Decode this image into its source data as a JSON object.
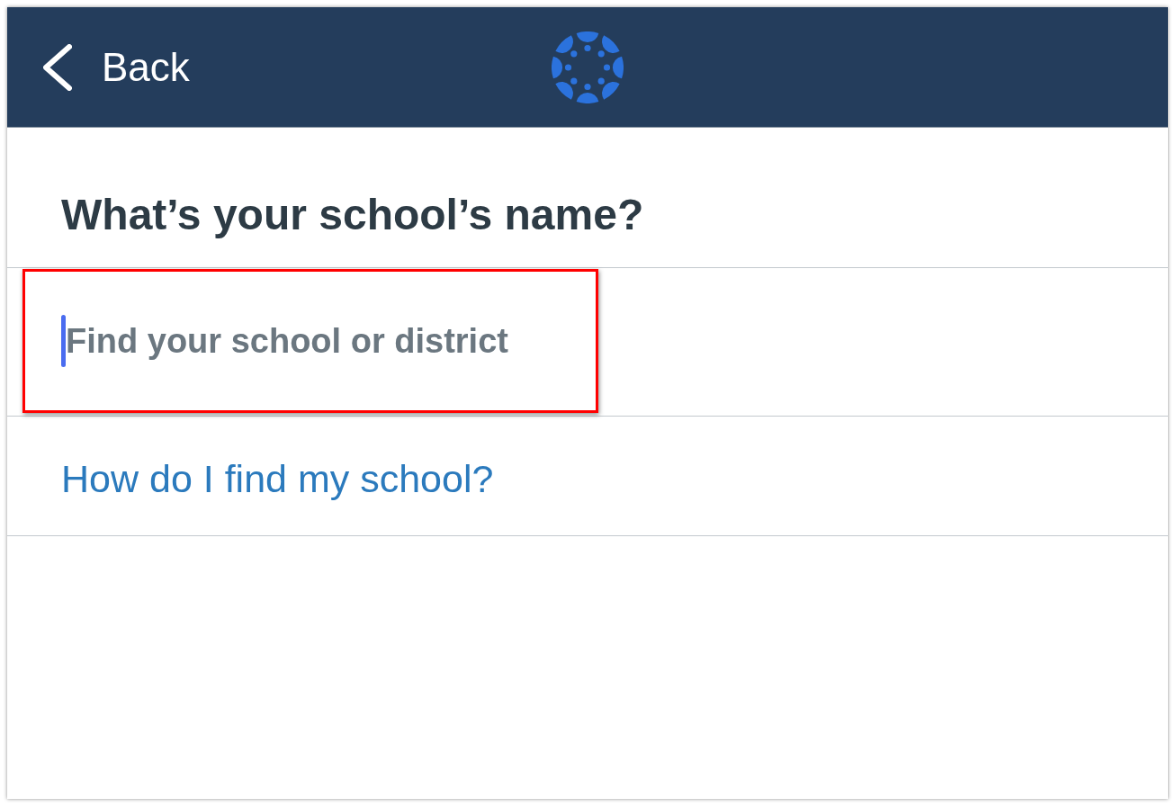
{
  "header": {
    "back_label": "Back"
  },
  "question": "What’s your school’s name?",
  "search": {
    "placeholder": "Find your school or district",
    "focused": true,
    "highlighted": true
  },
  "help_link": "How do I find my school?"
}
